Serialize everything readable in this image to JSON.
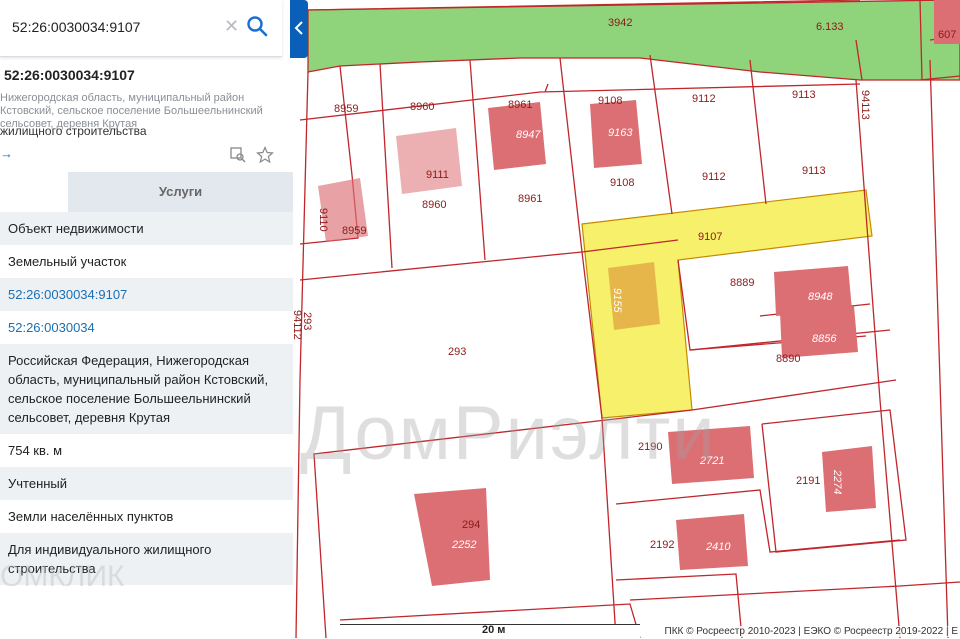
{
  "search": {
    "value": "52:26:0030034:9107"
  },
  "object": {
    "title": "52:26:0030034:9107",
    "address": "Нижегородская область, муниципальный район Кстовский, сельское поселение Большеельнинский сельсовет, деревня Крутая",
    "type": "жилищного строительства"
  },
  "tabs": {
    "services": "Услуги"
  },
  "rows": [
    "Объект недвижимости",
    "Земельный участок",
    "52:26:0030034:9107",
    "52:26:0030034",
    "Российская Федерация, Нижегородская область, муниципальный район Кстовский, сельское поселение Большеельнинский сельсовет, деревня Крутая",
    "754 кв. м",
    "Учтенный",
    "Земли населённых пунктов",
    "Для индивидуального жилищного строительства"
  ],
  "map": {
    "labels": {
      "l3942": "3942",
      "l6133": "6.133",
      "l607": "607",
      "l8959": "8959",
      "l8960": "8960",
      "l8961": "8961",
      "l9108": "9108",
      "l9112": "9112",
      "l9113": "9113",
      "l94113": "94113",
      "l9111": "9111",
      "l8947": "8947",
      "l9163": "9163",
      "l8959b": "8959",
      "l9110": "9110",
      "l8960b": "8960",
      "l8961b": "8961",
      "l9108b": "9108",
      "l9112b": "9112",
      "l9113b": "9113",
      "l9107": "9107",
      "l8889": "8889",
      "l8948": "8948",
      "l8856": "8856",
      "l8890": "8890",
      "l293": "293",
      "l293b": "293",
      "l94112": "94112",
      "l9155": "9155",
      "l2190": "2190",
      "l2721": "2721",
      "l2191": "2191",
      "l2274": "2274",
      "l294": "294",
      "l2252": "2252",
      "l2192": "2192",
      "l2410": "2410"
    },
    "scale": "20 м",
    "copyright": "ПКК © Росреестр 2010-2023 | ЕЭКО © Росреестр 2019-2022 | Е"
  },
  "watermark": "ДомРиэлти",
  "watermark2": "ОМКЛИК",
  "colors": {
    "boundary": "#c0262b",
    "green_zone": "#8fd47a",
    "selected_parcel": "#f7f06a",
    "building": "#dc6f74",
    "accent": "#0a60b8"
  }
}
